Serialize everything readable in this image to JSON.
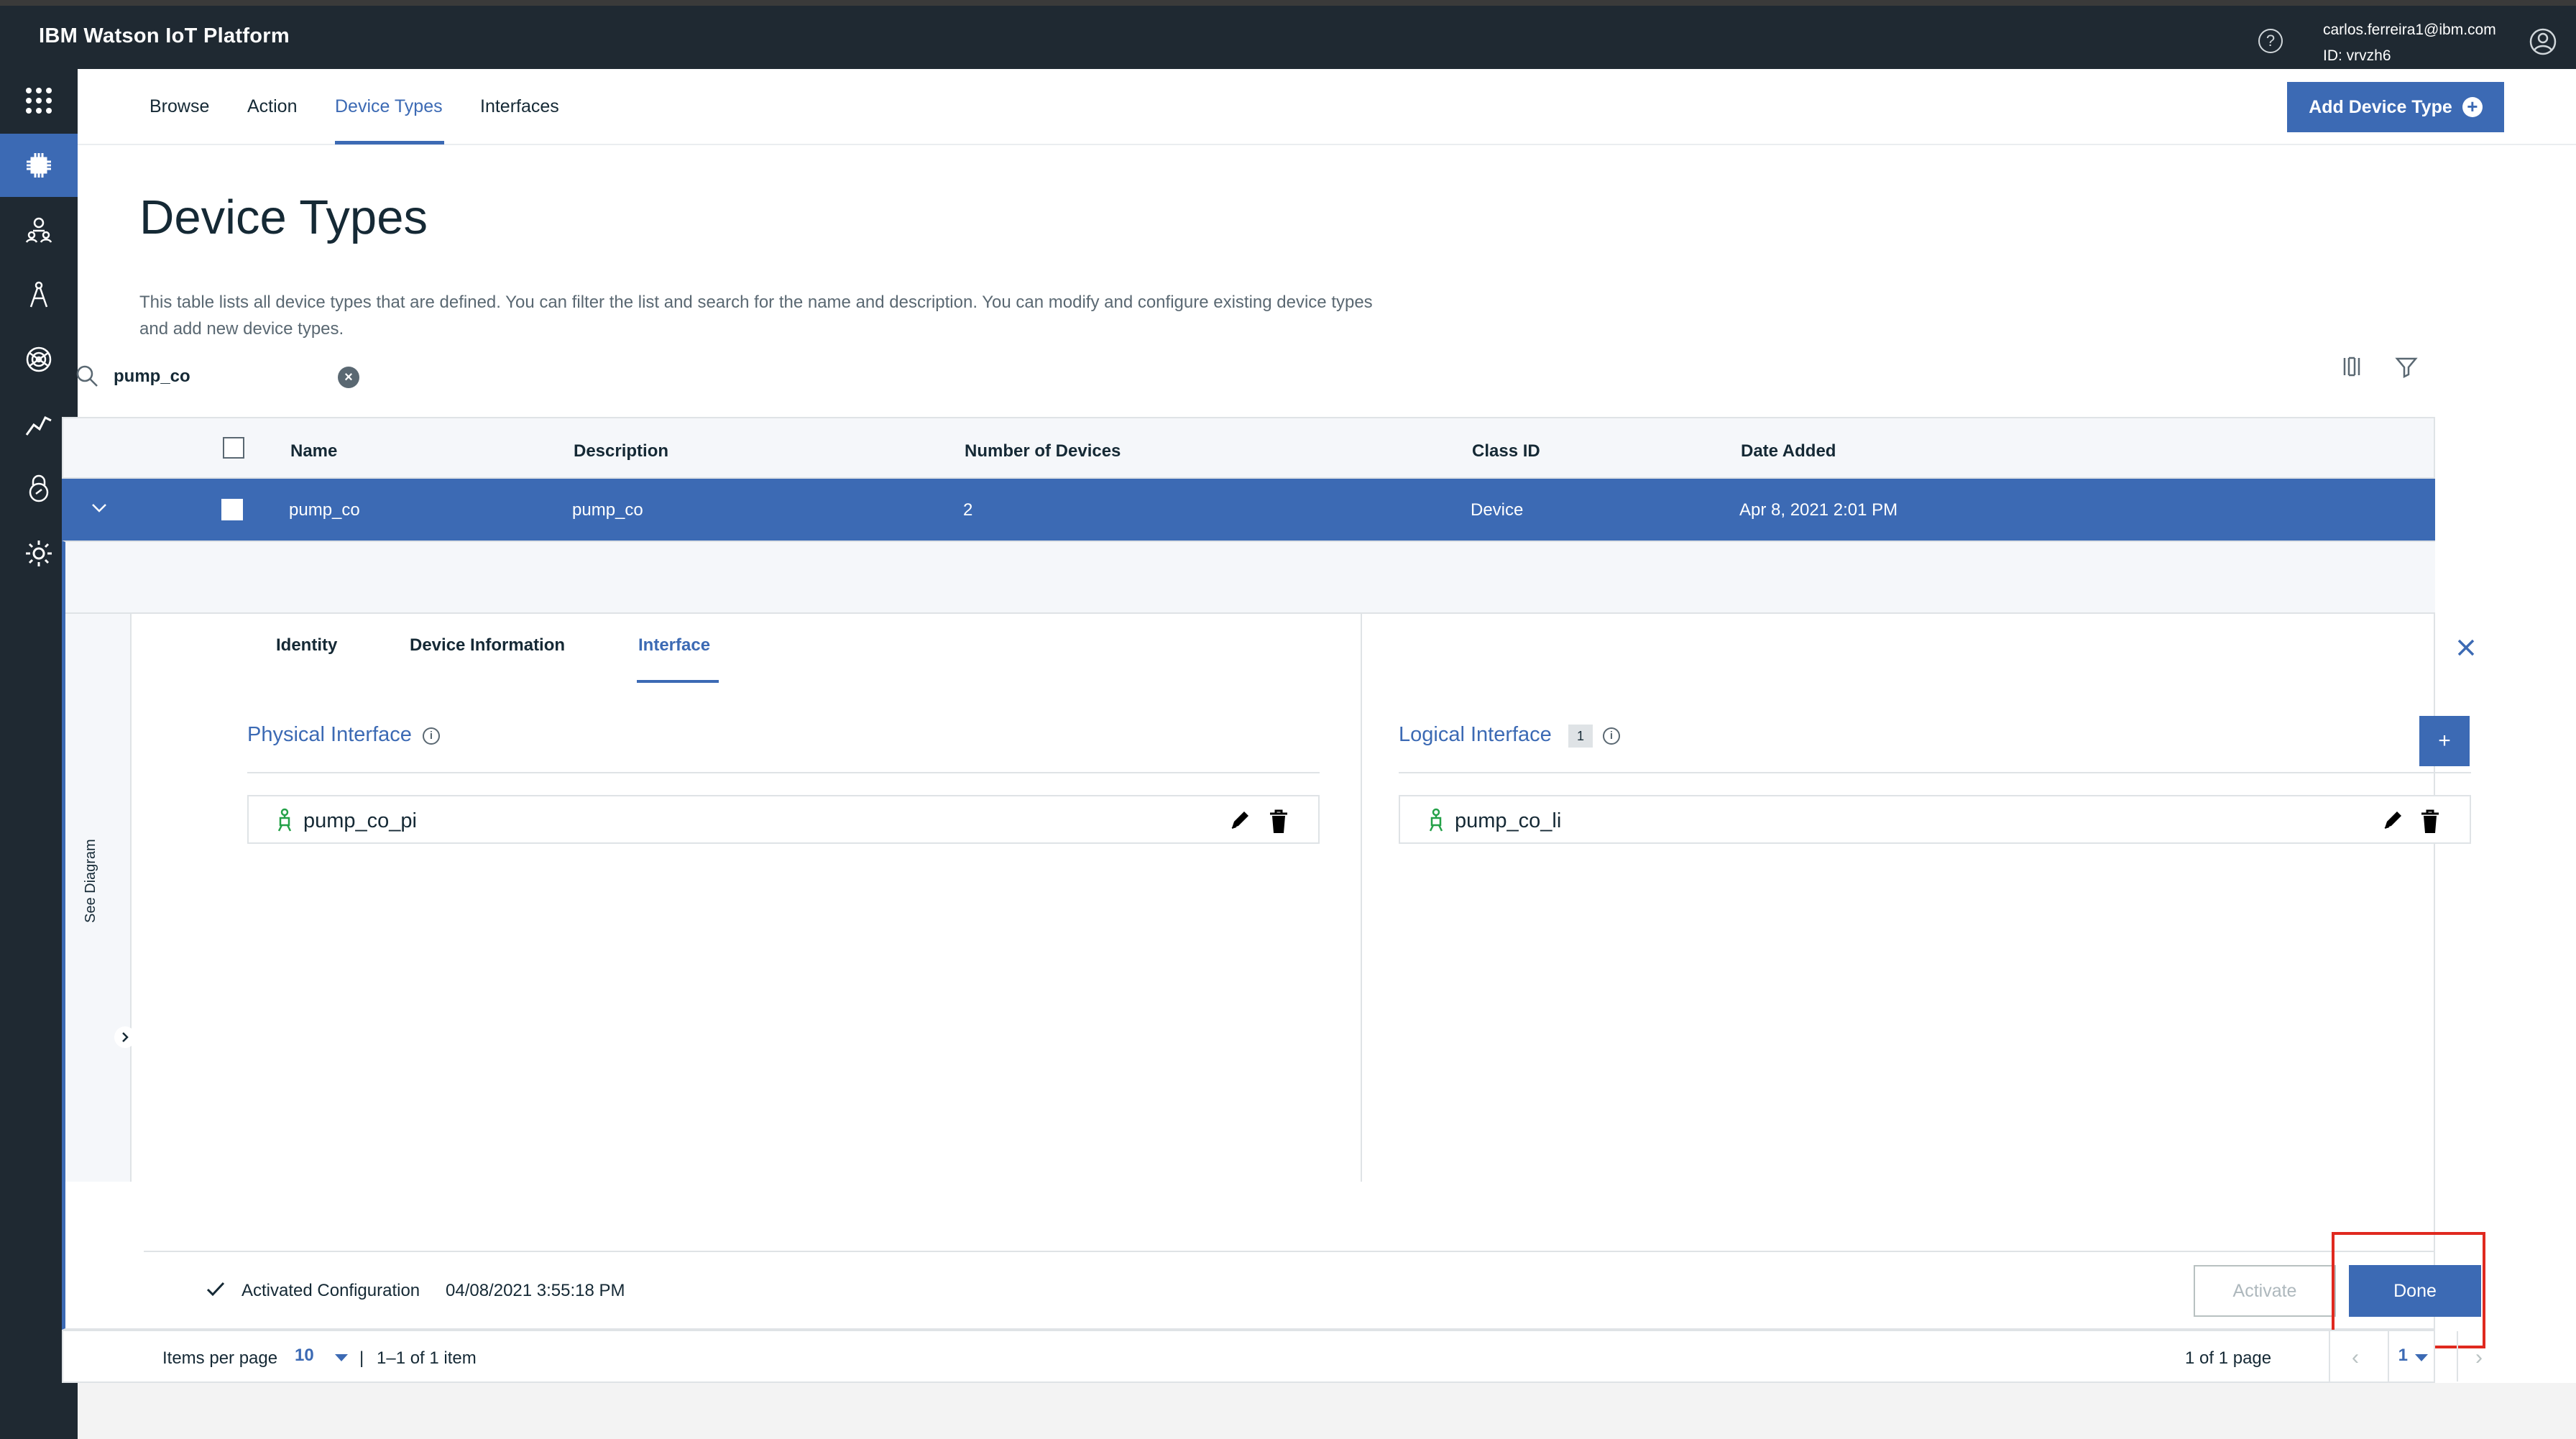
{
  "header": {
    "brand": "IBM Watson IoT Platform",
    "user_email": "carlos.ferreira1@ibm.com",
    "user_id": "ID: vrvzh6",
    "help_icon": "?"
  },
  "rail": {
    "items": [
      "apps-grid-icon",
      "devices-chip-icon",
      "members-icon",
      "apps-compass-icon",
      "rules-icon",
      "usage-chart-icon",
      "security-lock-icon",
      "settings-gear-icon"
    ],
    "active_index": 1
  },
  "nav": {
    "tabs": [
      "Browse",
      "Action",
      "Device Types",
      "Interfaces"
    ],
    "active_tab": "Device Types",
    "add_button": "Add Device Type"
  },
  "page": {
    "title": "Device Types",
    "description": "This table lists all device types that are defined. You can filter the list and search for the name and description. You can modify and configure existing device types and add new device types."
  },
  "search": {
    "value": "pump_co",
    "clear_glyph": "×"
  },
  "table": {
    "headers": {
      "name": "Name",
      "description": "Description",
      "devices": "Number of Devices",
      "class_id": "Class ID",
      "date_added": "Date Added"
    },
    "row": {
      "name": "pump_co",
      "description": "pump_co",
      "devices": "2",
      "class_id": "Device",
      "date_added": "Apr 8, 2021 2:01 PM"
    }
  },
  "details": {
    "tabs": [
      "Identity",
      "Device Information",
      "Interface"
    ],
    "active_tab": "Interface",
    "see_diagram": "See Diagram",
    "physical": {
      "title": "Physical Interface",
      "info": "i",
      "item": "pump_co_pi"
    },
    "logical": {
      "title": "Logical Interface",
      "count": "1",
      "info": "i",
      "add": "+",
      "item": "pump_co_li"
    },
    "activated_label": "Activated Configuration",
    "activated_time": "04/08/2021 3:55:18 PM",
    "activate_button": "Activate",
    "done_button": "Done"
  },
  "pagination": {
    "items_per_page_label": "Items per page",
    "items_per_page": "10",
    "divider": "|",
    "range": "1–1 of 1 item",
    "page_of": "1 of 1 page",
    "current_page": "1",
    "prev": "‹",
    "next": "›"
  },
  "colors": {
    "accent": "#3c6ab4",
    "header_bg": "#1f2932",
    "highlight": "#e0291f",
    "robot_green": "#24a148"
  }
}
